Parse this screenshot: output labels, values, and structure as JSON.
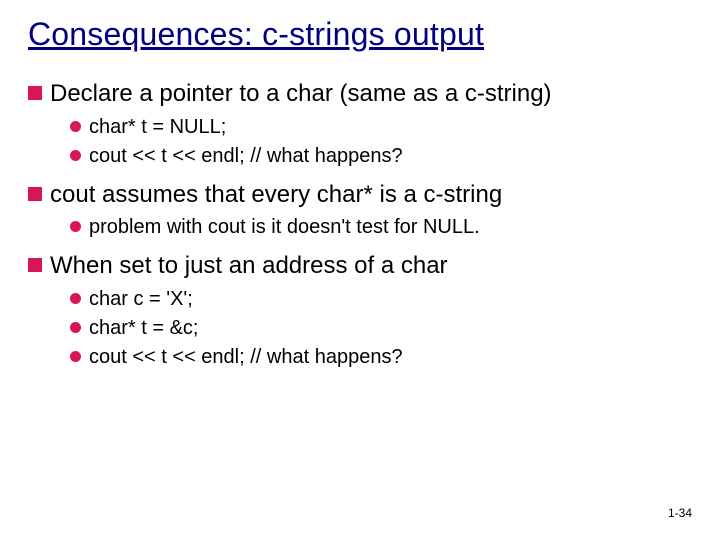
{
  "title": "Consequences: c-strings output",
  "points": [
    {
      "text": "Declare a pointer to a char (same as a c-string)",
      "sub": [
        "char* t = NULL;",
        "cout << t << endl;  // what happens?"
      ]
    },
    {
      "text": "cout assumes that every char* is a c-string",
      "sub": [
        "problem with cout is it doesn't test for NULL."
      ]
    },
    {
      "text": "When set to just an address of a char",
      "sub": [
        "char c = 'X';",
        "char* t = &c;",
        "cout << t << endl;  // what happens?"
      ]
    }
  ],
  "footer": "1-34"
}
